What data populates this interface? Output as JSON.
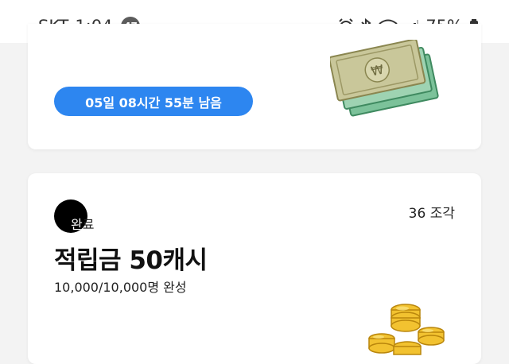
{
  "status_bar": {
    "carrier": "SKT",
    "time": "1:04",
    "notification_count": "47",
    "battery_percent": "75%",
    "icons": [
      "alarm-icon",
      "bluetooth-icon",
      "wifi-icon",
      "signal-icon",
      "battery-icon"
    ]
  },
  "event_card": {
    "timer_label": "05일 08시간 55분 남음",
    "image": "cash-money-stack",
    "pill_color": "#2d86f0"
  },
  "reward_card": {
    "badge_text_part1": "완",
    "badge_text_part2": "료",
    "pieces_label": "36 조각",
    "title": "적립금 50캐시",
    "participants_label": "10,000/10,000명 완성",
    "image": "gold-coin-stack"
  }
}
